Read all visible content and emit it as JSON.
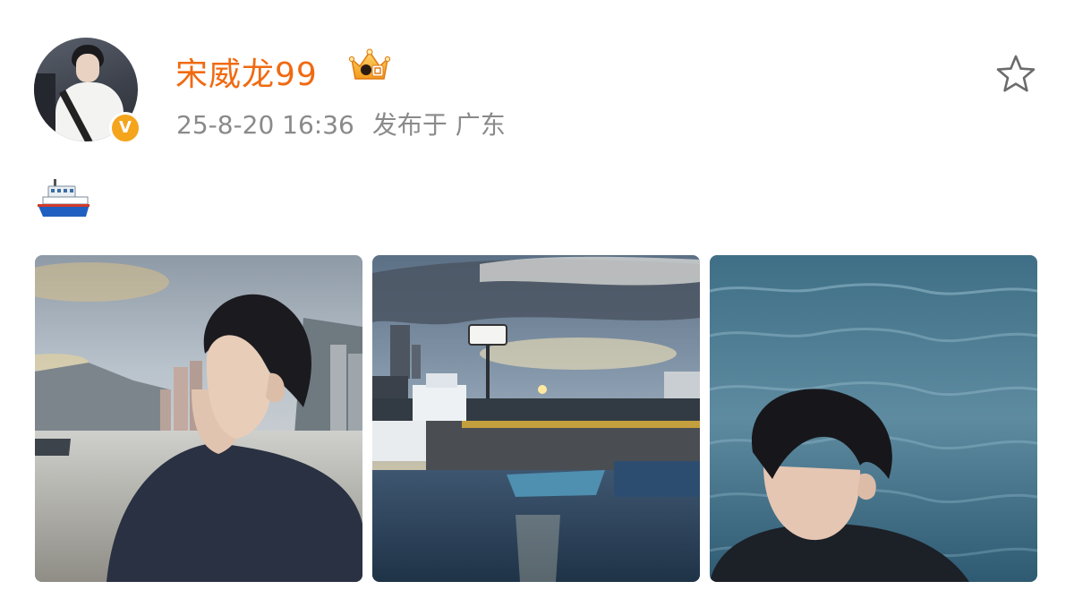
{
  "post": {
    "author": {
      "name": "宋威龙99",
      "verified_badge": "V"
    },
    "timestamp": "25-8-20 16:36",
    "location_label": "发布于 广东",
    "content_emoji": "ship-emoji",
    "images": [
      {
        "alt": "photo-1"
      },
      {
        "alt": "photo-2"
      },
      {
        "alt": "photo-3"
      }
    ]
  },
  "colors": {
    "username": "#f06a12",
    "meta": "#8a8a8a",
    "verified": "#f4a51c"
  }
}
